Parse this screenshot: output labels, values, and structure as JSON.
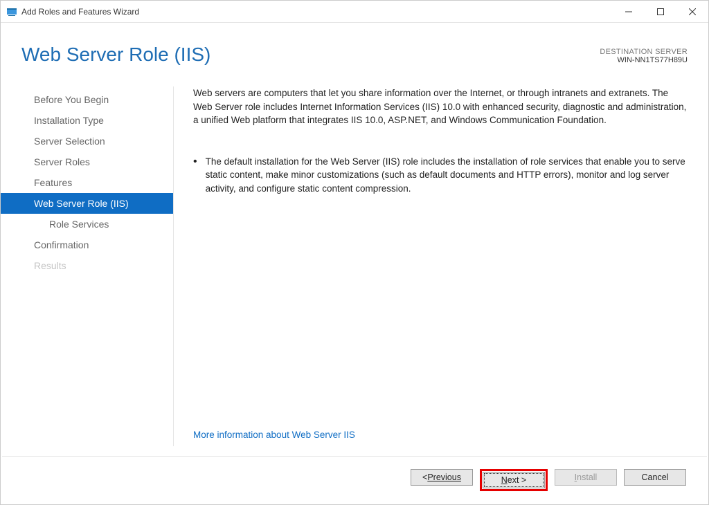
{
  "titlebar": {
    "title": "Add Roles and Features Wizard"
  },
  "header": {
    "page_title": "Web Server Role (IIS)",
    "destination_label": "DESTINATION SERVER",
    "destination_name": "WIN-NN1TS77H89U"
  },
  "nav": {
    "items": [
      {
        "label": "Before You Begin",
        "selected": false,
        "indent": false,
        "disabled": false
      },
      {
        "label": "Installation Type",
        "selected": false,
        "indent": false,
        "disabled": false
      },
      {
        "label": "Server Selection",
        "selected": false,
        "indent": false,
        "disabled": false
      },
      {
        "label": "Server Roles",
        "selected": false,
        "indent": false,
        "disabled": false
      },
      {
        "label": "Features",
        "selected": false,
        "indent": false,
        "disabled": false
      },
      {
        "label": "Web Server Role (IIS)",
        "selected": true,
        "indent": false,
        "disabled": false
      },
      {
        "label": "Role Services",
        "selected": false,
        "indent": true,
        "disabled": false
      },
      {
        "label": "Confirmation",
        "selected": false,
        "indent": false,
        "disabled": false
      },
      {
        "label": "Results",
        "selected": false,
        "indent": false,
        "disabled": true
      }
    ]
  },
  "content": {
    "intro": "Web servers are computers that let you share information over the Internet, or through intranets and extranets. The Web Server role includes Internet Information Services (IIS) 10.0 with enhanced security, diagnostic and administration, a unified Web platform that integrates IIS 10.0, ASP.NET, and Windows Communication Foundation.",
    "bullets": [
      "The default installation for the Web Server (IIS) role includes the installation of role services that enable you to serve static content, make minor customizations (such as default documents and HTTP errors), monitor and log server activity, and configure static content compression."
    ],
    "link": "More information about Web Server IIS"
  },
  "footer": {
    "previous": "Previous",
    "next": "Next >",
    "install": "Install",
    "cancel": "Cancel"
  }
}
